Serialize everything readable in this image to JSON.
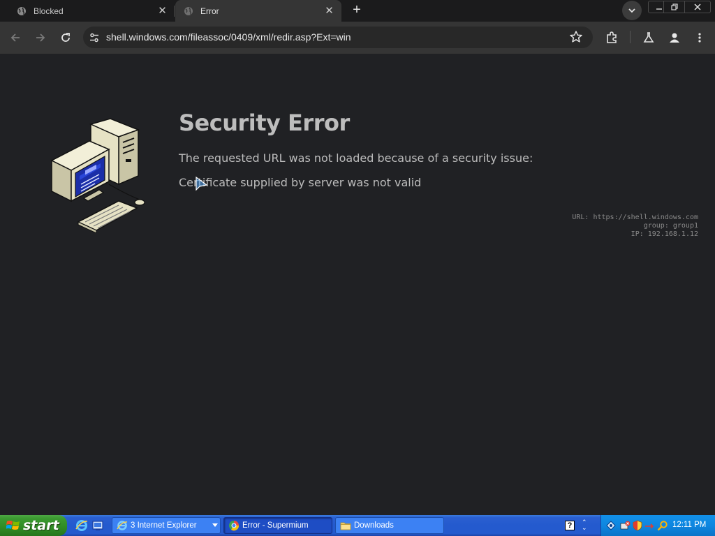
{
  "browser": {
    "tabs": [
      {
        "title": "Blocked",
        "active": false
      },
      {
        "title": "Error",
        "active": true
      }
    ],
    "address_bar": {
      "url": "shell.windows.com/fileassoc/0409/xml/redir.asp?Ext=win"
    }
  },
  "page": {
    "title": "Security Error",
    "message": "The requested URL was not loaded because of a security issue:",
    "detail": "Certificate supplied by server was not valid",
    "diagnostics": {
      "url": "URL: https://shell.windows.com",
      "group": "group: group1",
      "ip": "IP: 192.168.1.12"
    }
  },
  "taskbar": {
    "start_label": "start",
    "buttons": [
      {
        "label": "3 Internet Explorer",
        "icon": "ie-icon",
        "active": false
      },
      {
        "label": "Error - Supermium",
        "icon": "supermium-icon",
        "active": true
      },
      {
        "label": "Downloads",
        "icon": "folder-icon",
        "active": false
      }
    ],
    "clock": "12:11 PM"
  },
  "colors": {
    "page_background": "#202124",
    "toolbar": "#353535",
    "taskbar_blue": "#245ace",
    "start_green": "#3c9b31",
    "tray_blue": "#0e86e0"
  }
}
